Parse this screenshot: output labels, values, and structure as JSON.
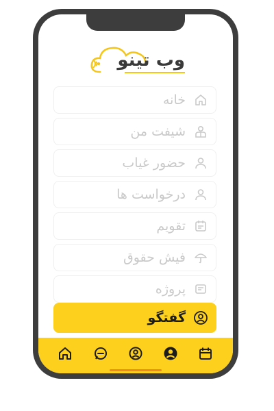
{
  "logo": {
    "text": "وب تینو",
    "icon": "cloud-signal-icon"
  },
  "menu": {
    "items": [
      {
        "label": "خانه",
        "icon": "home-icon"
      },
      {
        "label": "شیفت من",
        "icon": "user-shift-icon"
      },
      {
        "label": "حضور غیاب",
        "icon": "user-icon"
      },
      {
        "label": "درخواست ها",
        "icon": "user-icon"
      },
      {
        "label": "تقویم",
        "icon": "calendar-icon"
      },
      {
        "label": "فیش حقوق",
        "icon": "umbrella-icon"
      },
      {
        "label": "پروژه",
        "icon": "folder-icon"
      },
      {
        "label": "گفتگو",
        "icon": "chat-user-icon",
        "active": true
      }
    ]
  },
  "bottom_nav": {
    "items": [
      {
        "icon": "home-icon"
      },
      {
        "icon": "chat-icon"
      },
      {
        "icon": "user-circle-icon"
      },
      {
        "icon": "profile-icon"
      },
      {
        "icon": "calendar-icon"
      }
    ]
  },
  "colors": {
    "accent": "#fcd01c",
    "phone_frame": "#3d3d3d",
    "inactive_text": "#c9c9c9",
    "home_indicator": "#f08a24"
  }
}
